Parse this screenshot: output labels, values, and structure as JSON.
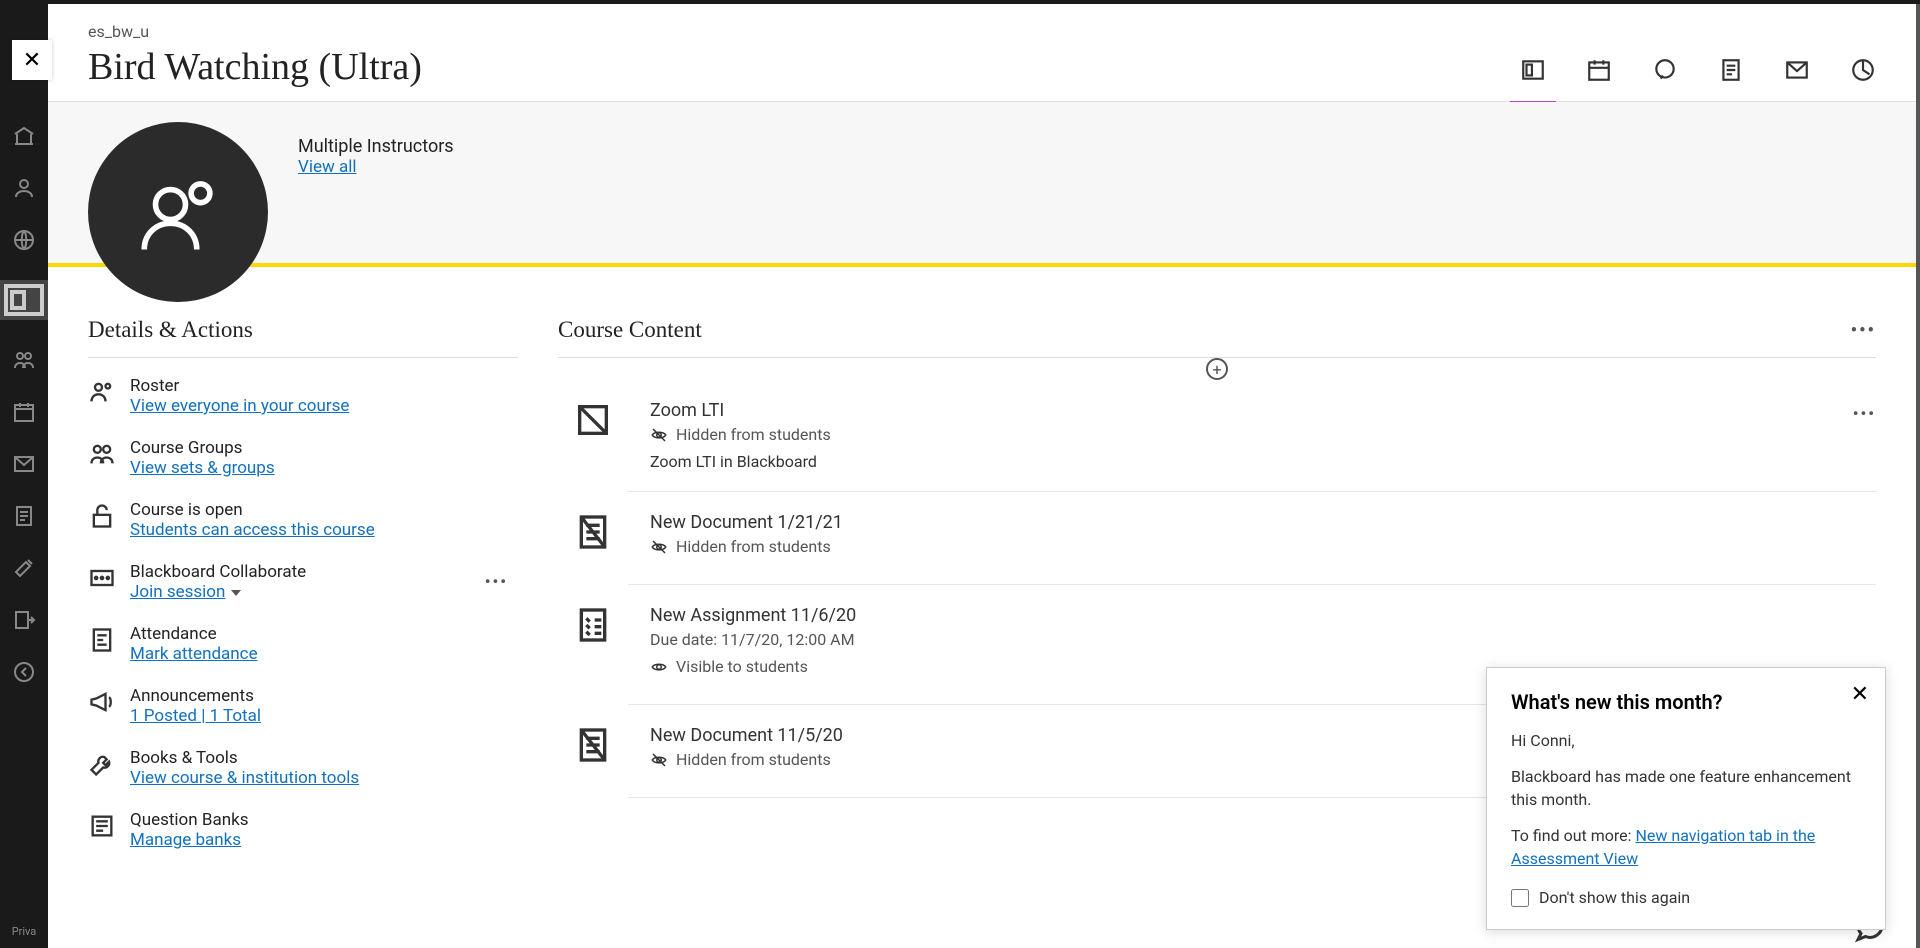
{
  "breadcrumb": "es_bw_u",
  "course_title": "Bird Watching (Ultra)",
  "close_label": "✕",
  "header_tabs": [
    {
      "name": "content-icon",
      "active": true
    },
    {
      "name": "calendar-icon",
      "active": false
    },
    {
      "name": "discussions-icon",
      "active": false
    },
    {
      "name": "gradebook-icon",
      "active": false
    },
    {
      "name": "messages-icon",
      "active": false
    },
    {
      "name": "analytics-icon",
      "active": false
    }
  ],
  "banner": {
    "instructors_label": "Multiple Instructors",
    "view_all": "View all"
  },
  "details_title": "Details & Actions",
  "actions": {
    "roster": {
      "title": "Roster",
      "link": "View everyone in your course"
    },
    "groups": {
      "title": "Course Groups",
      "link": "View sets & groups"
    },
    "access": {
      "title": "Course is open",
      "link": "Students can access this course"
    },
    "collab": {
      "title": "Blackboard Collaborate",
      "link": "Join session"
    },
    "attendance": {
      "title": "Attendance",
      "link": "Mark attendance"
    },
    "announcements": {
      "title": "Announcements",
      "link": "1 Posted  |  1 Total"
    },
    "books": {
      "title": "Books & Tools",
      "link": "View course & institution tools"
    },
    "qbanks": {
      "title": "Question Banks",
      "link": "Manage banks"
    }
  },
  "content_title": "Course Content",
  "content_items": [
    {
      "title": "Zoom LTI",
      "visibility": "Hidden from students",
      "vis_icon": "hidden",
      "description": "Zoom LTI in Blackboard",
      "show_more": true,
      "icon": "lti"
    },
    {
      "title": "New Document 1/21/21",
      "visibility": "Hidden from students",
      "vis_icon": "hidden",
      "icon": "doc"
    },
    {
      "title": "New Assignment 11/6/20",
      "subtitle": "Due date: 11/7/20, 12:00 AM",
      "visibility": "Visible to students",
      "vis_icon": "visible",
      "icon": "assign"
    },
    {
      "title": "New Document 11/5/20",
      "visibility": "Hidden from students",
      "vis_icon": "hidden",
      "icon": "doc"
    }
  ],
  "popup": {
    "title": "What's new this month?",
    "greeting": "Hi Conni,",
    "body": "Blackboard has made one feature enhancement this month.",
    "cta_prefix": "To find out more: ",
    "cta_link": "New navigation tab in the Assessment View",
    "checkbox_label": "Don't show this again"
  },
  "leftrail_bottom": "Priva"
}
